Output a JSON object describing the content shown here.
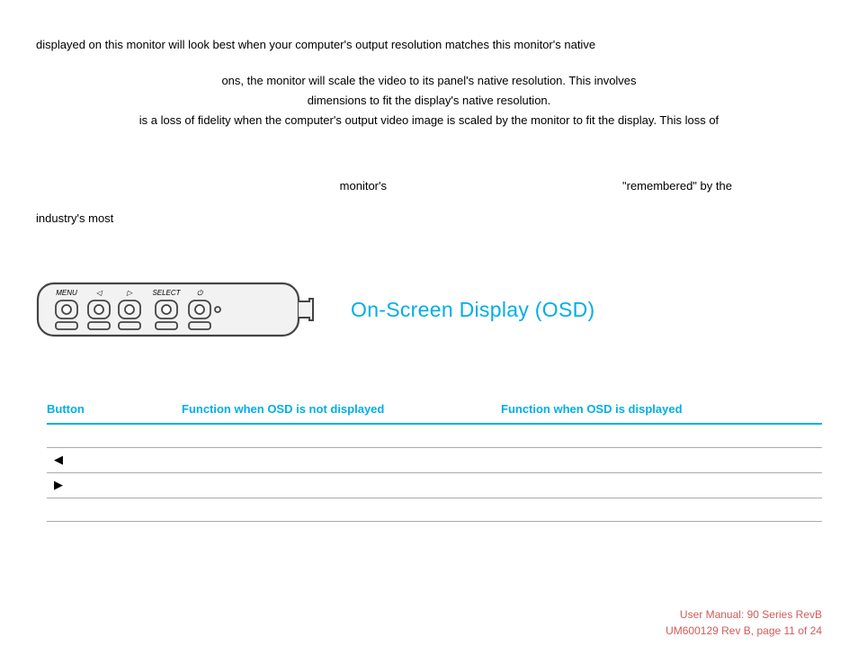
{
  "para": {
    "l1": "displayed on this monitor will look best when your computer's output resolution matches this monitor's native",
    "l2": "ons, the monitor will scale the video to its panel's native resolution. This involves",
    "l3": "dimensions to fit the display's native resolution.",
    "l4": "is a loss of fidelity when the computer's output video image is scaled by the monitor to fit the display. This loss of",
    "l5a": "monitor's",
    "l5b": "\"remembered\" by the",
    "l6": "industry's most"
  },
  "heading": "On-Screen Display (OSD)",
  "panel_labels": {
    "menu": "MENU",
    "left": "◁",
    "right": "▷",
    "select": "SELECT",
    "power": "⏻"
  },
  "table": {
    "headers": {
      "col1": "Button",
      "col2": "Function when OSD is not displayed",
      "col3": "Function when OSD is displayed"
    },
    "rows": [
      {
        "button": "◀"
      },
      {
        "button": "▶"
      }
    ]
  },
  "footer": {
    "line1": "User Manual: 90 Series RevB",
    "line2": "UM600129 Rev B, page 11 of 24"
  }
}
